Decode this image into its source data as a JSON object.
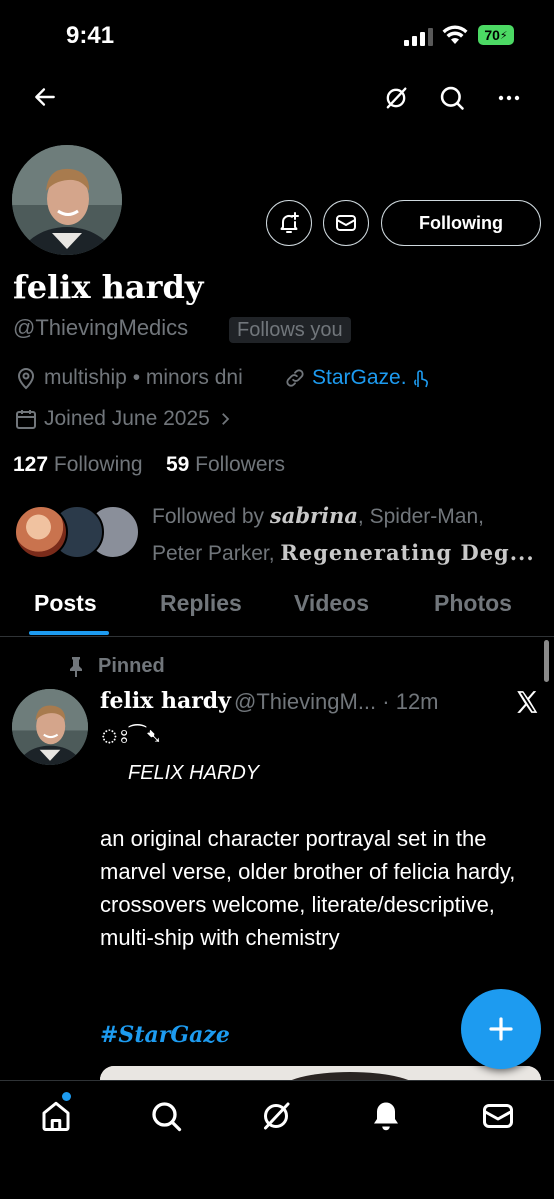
{
  "status": {
    "time": "9:41",
    "battery": "70"
  },
  "profile": {
    "display_name": "felix hardy",
    "handle": "@ThievingMedics",
    "follows_you": "Follows you",
    "following_button": "Following",
    "location": "multiship • minors dni",
    "website": "StarGaze.",
    "joined": "Joined June 2025",
    "following_count": "127",
    "following_label": "Following",
    "followers_count": "59",
    "followers_label": "Followers",
    "followed_by_prefix": "Followed by ",
    "followed_by_name1": "𝒔𝒂𝒃𝒓𝒊𝒏𝒂",
    "followed_by_middle": ", Spider-Man,",
    "followed_by_line2_prefix": "Peter Parker, ",
    "followed_by_name4": "Regenerating Deg...",
    "follower_avatar_colors": [
      "#c9734e",
      "#2b3a4a",
      "#8a8f9a"
    ]
  },
  "tabs": [
    {
      "label": "Posts",
      "active": true
    },
    {
      "label": "Replies",
      "active": false
    },
    {
      "label": "Videos",
      "active": false
    },
    {
      "label": "Photos",
      "active": false
    }
  ],
  "post": {
    "pinned_label": "Pinned",
    "author_name": "felix hardy",
    "author_handle_time": "@ThievingM... · 12m",
    "decoration": "ঃ⁀➷",
    "title": "FELIX HARDY",
    "body": "an original character portrayal set in the marvel verse, older brother of felicia hardy, crossovers welcome, literate/descriptive, multi-ship with chemistry",
    "hashtag": "#StarGaze"
  },
  "icons": {
    "back": "back-arrow-icon",
    "grok": "grok-icon",
    "search": "search-icon",
    "more": "more-icon",
    "notify": "bell-plus-icon",
    "message": "mail-icon",
    "location": "location-pin-icon",
    "link": "link-icon",
    "calendar": "calendar-icon",
    "pin": "pin-icon",
    "x": "x-logo-icon",
    "compose": "plus-icon"
  },
  "colors": {
    "accent": "#1d9bf0",
    "muted": "#71767b",
    "background": "#000000"
  }
}
